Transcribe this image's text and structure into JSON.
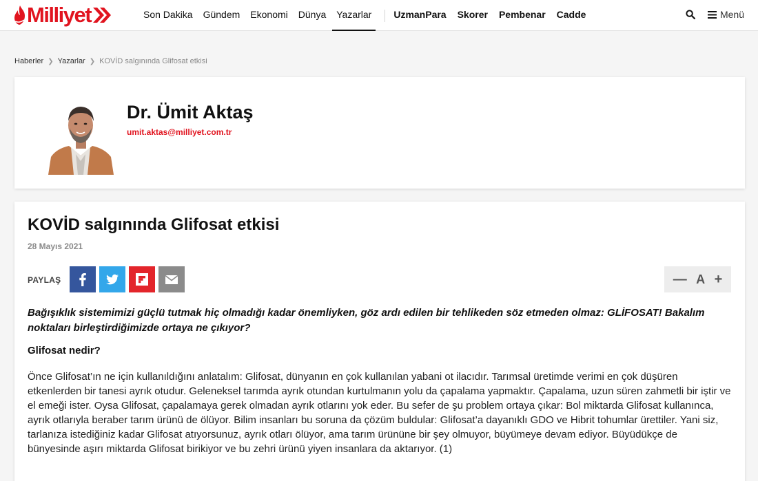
{
  "header": {
    "logo_text": "Milliyet",
    "nav": [
      "Son Dakika",
      "Gündem",
      "Ekonomi",
      "Dünya",
      "Yazarlar"
    ],
    "active_nav": "Yazarlar",
    "nav_brands": [
      "UzmanPara",
      "Skorer",
      "Pembenar",
      "Cadde"
    ],
    "menu_label": "Menü",
    "colors": {
      "brand": "#e1141f"
    }
  },
  "breadcrumb": {
    "items": [
      "Haberler",
      "Yazarlar"
    ],
    "current": "KOVİD salgınında Glifosat etkisi"
  },
  "author": {
    "name": "Dr. Ümit Aktaş",
    "email": "umit.aktas@milliyet.com.tr"
  },
  "article": {
    "title": "KOVİD salgınında Glifosat etkisi",
    "date": "28 Mayıs 2021",
    "share_label": "PAYLAŞ",
    "share_buttons": [
      {
        "icon": "facebook-icon",
        "color": "#35569d"
      },
      {
        "icon": "twitter-icon",
        "color": "#33a7ea"
      },
      {
        "icon": "flipboard-icon",
        "color": "#e3252b"
      },
      {
        "icon": "email-icon",
        "color": "#8b8b8b"
      }
    ],
    "font_tools": {
      "decrease": "—",
      "label": "A",
      "increase": "+"
    },
    "lead": "Bağışıklık sistemimizi güçlü tutmak hiç olmadığı kadar önemliyken, göz ardı edilen bir tehlikeden söz etmeden olmaz: GLİFOSAT! Bakalım noktaları birleştirdiğimizde ortaya ne çıkıyor?",
    "subhead": "Glifosat nedir?",
    "body": "Önce Glifosat’ın ne için kullanıldığını anlatalım: Glifosat, dünyanın en çok kullanılan yabani ot ilacıdır. Tarımsal üretimde verimi en çok düşüren etkenlerden bir tanesi ayrık otudur. Geleneksel tarımda ayrık otundan kurtulmanın yolu da çapalama yapmaktır. Çapalama, uzun süren zahmetli bir iştir ve el emeği ister. Oysa Glifosat, çapalamaya gerek olmadan ayrık otlarını yok eder. Bu sefer de şu problem ortaya çıkar: Bol miktarda Glifosat kullanınca, ayrık otlarıyla beraber tarım ürünü de ölüyor. Bilim insanları bu soruna da çözüm buldular: Glifosat’a dayanıklı GDO ve Hibrit tohumlar ürettiler. Yani siz, tarlanıza istediğiniz kadar Glifosat atıyorsunuz, ayrık otları ölüyor, ama tarım ürününe bir şey olmuyor, büyümeye devam ediyor. Büyüdükçe de bünyesinde aşırı miktarda Glifosat birikiyor ve bu zehri ürünü yiyen insanlara da aktarıyor. (1)"
  }
}
